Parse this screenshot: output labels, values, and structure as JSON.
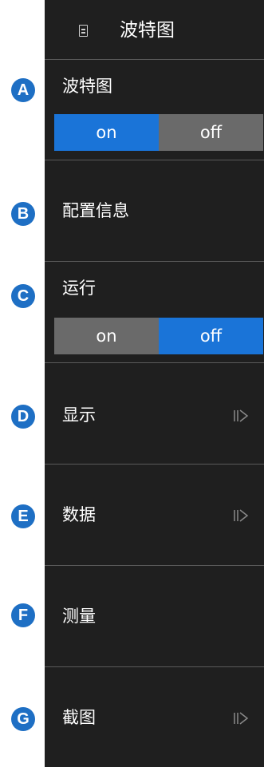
{
  "header": {
    "title": "波特图",
    "icon": "document-icon"
  },
  "sections": {
    "bode": {
      "label": "波特图",
      "on": "on",
      "off": "off",
      "selected": "on"
    },
    "config": {
      "label": "配置信息"
    },
    "run": {
      "label": "运行",
      "on": "on",
      "off": "off",
      "selected": "off"
    },
    "display": {
      "label": "显示"
    },
    "data": {
      "label": "数据"
    },
    "measure": {
      "label": "测量"
    },
    "screenshot": {
      "label": "截图"
    }
  },
  "badges": [
    "A",
    "B",
    "C",
    "D",
    "E",
    "F",
    "G"
  ],
  "colors": {
    "panel": "#1f1f1f",
    "accent": "#1a74d8",
    "inactive": "#6a6a6a",
    "badge": "#1e6fc4"
  }
}
